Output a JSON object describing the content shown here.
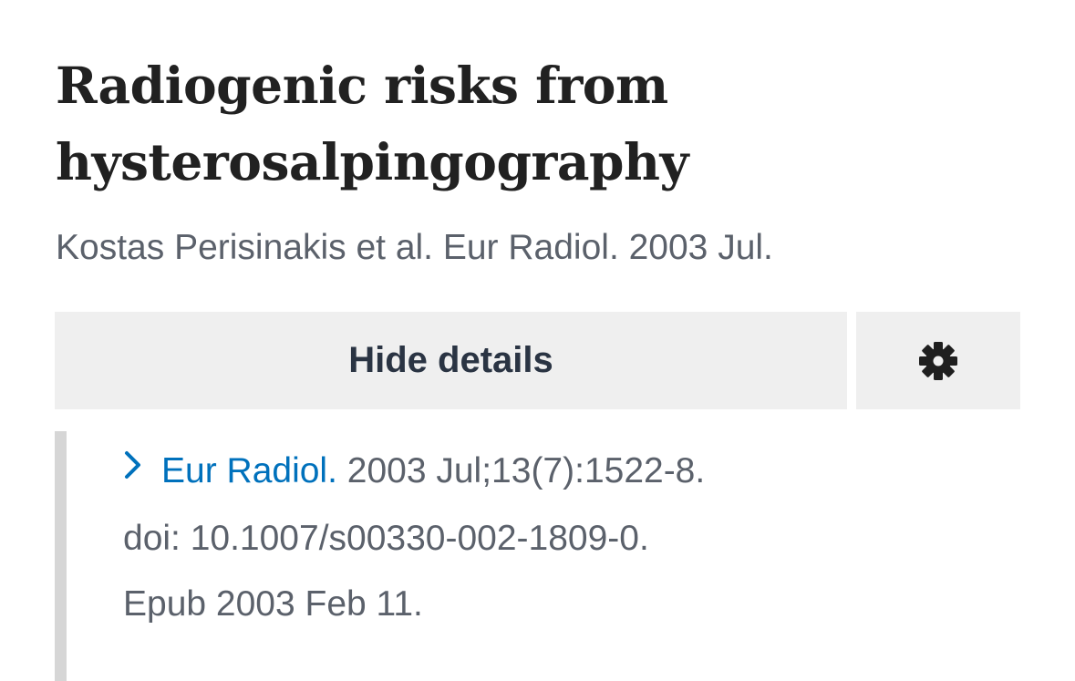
{
  "article": {
    "title_line1": "Radiogenic risks from",
    "title_line2": "hysterosalpingography",
    "authors": "Kostas Perisinakis et al. Eur Radiol. 2003 Jul."
  },
  "actions": {
    "hide_details_label": "Hide details",
    "settings_icon": "gear-icon"
  },
  "details": {
    "expand_icon": "chevron-right-icon",
    "journal_link": "Eur Radiol.",
    "citation": " 2003 Jul;13(7):1522-8.",
    "doi_line": "doi: 10.1007/s00330-002-1809-0.",
    "epub_line": "Epub 2003 Feb 11."
  },
  "colors": {
    "link": "#0071bc",
    "text_muted": "#5b616b",
    "button_bg": "#efefef",
    "heading": "#212121",
    "button_text": "#2a3443",
    "details_border": "#d6d6d6"
  }
}
